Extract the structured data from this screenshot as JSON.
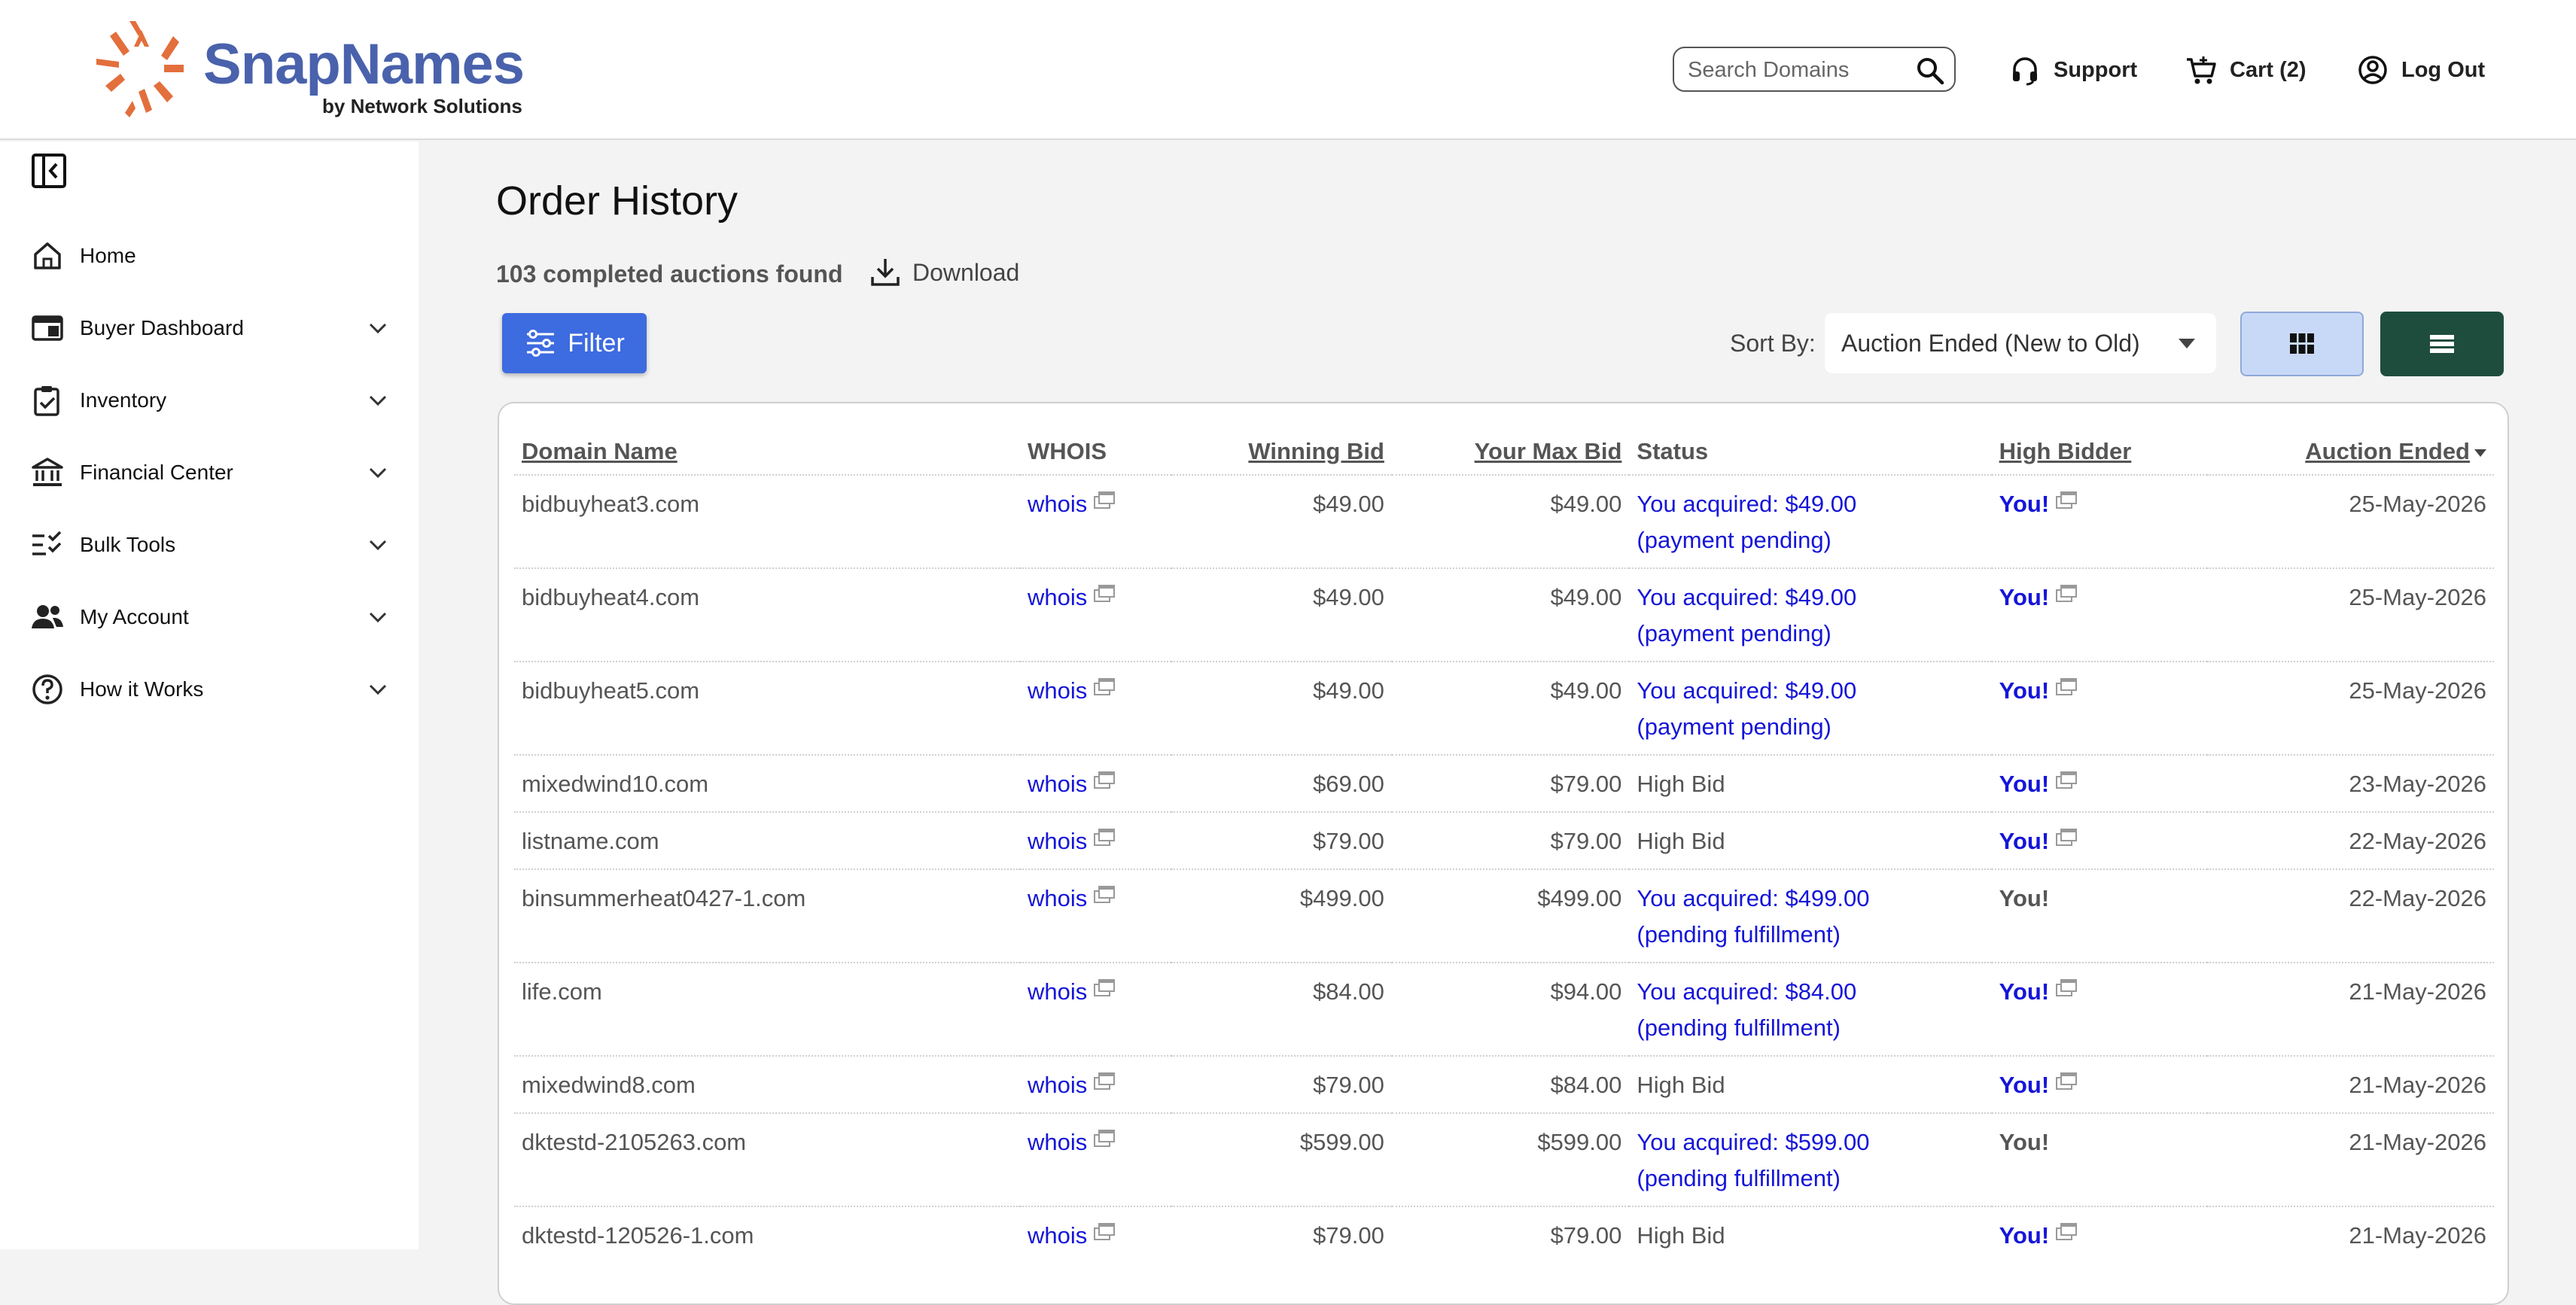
{
  "header": {
    "brand": "SnapNames",
    "brand_sub": "by Network Solutions",
    "search_placeholder": "Search Domains",
    "support_label": "Support",
    "cart_label": "Cart (2)",
    "logout_label": "Log Out"
  },
  "colors": {
    "brand_blue": "#4a62ac",
    "brand_orange": "#e36f3c",
    "filter_blue": "#3d6be0",
    "link_blue": "#1515d8",
    "list_view_green": "#1e4d3e"
  },
  "sidebar": {
    "items": [
      {
        "label": "Home",
        "icon": "home-icon",
        "expandable": false
      },
      {
        "label": "Buyer Dashboard",
        "icon": "dashboard-icon",
        "expandable": true
      },
      {
        "label": "Inventory",
        "icon": "clipboard-icon",
        "expandable": true
      },
      {
        "label": "Financial Center",
        "icon": "bank-icon",
        "expandable": true
      },
      {
        "label": "Bulk Tools",
        "icon": "checklist-icon",
        "expandable": true
      },
      {
        "label": "My Account",
        "icon": "users-icon",
        "expandable": true
      },
      {
        "label": "How it Works",
        "icon": "help-icon",
        "expandable": true
      }
    ]
  },
  "main": {
    "title": "Order History",
    "count_text": "103 completed auctions found",
    "download_label": "Download",
    "filter_label": "Filter",
    "sort_label": "Sort By:",
    "sort_value": "Auction Ended (New to Old)"
  },
  "table": {
    "columns": [
      "Domain Name",
      "WHOIS",
      "Winning Bid",
      "Your Max Bid",
      "Status",
      "High Bidder",
      "Auction Ended"
    ],
    "rows": [
      {
        "domain": "bidbuyheat3.com",
        "whois": "whois",
        "winning": "$49.00",
        "max": "$49.00",
        "status1": "You acquired: $49.00",
        "status2": "(payment pending)",
        "acquired": true,
        "bidder": "You!",
        "bidder_link": true,
        "ended": "25-May-2026"
      },
      {
        "domain": "bidbuyheat4.com",
        "whois": "whois",
        "winning": "$49.00",
        "max": "$49.00",
        "status1": "You acquired: $49.00",
        "status2": "(payment pending)",
        "acquired": true,
        "bidder": "You!",
        "bidder_link": true,
        "ended": "25-May-2026"
      },
      {
        "domain": "bidbuyheat5.com",
        "whois": "whois",
        "winning": "$49.00",
        "max": "$49.00",
        "status1": "You acquired: $49.00",
        "status2": "(payment pending)",
        "acquired": true,
        "bidder": "You!",
        "bidder_link": true,
        "ended": "25-May-2026"
      },
      {
        "domain": "mixedwind10.com",
        "whois": "whois",
        "winning": "$69.00",
        "max": "$79.00",
        "status1": "High Bid",
        "status2": "",
        "acquired": false,
        "bidder": "You!",
        "bidder_link": true,
        "ended": "23-May-2026"
      },
      {
        "domain": "listname.com",
        "whois": "whois",
        "winning": "$79.00",
        "max": "$79.00",
        "status1": "High Bid",
        "status2": "",
        "acquired": false,
        "bidder": "You!",
        "bidder_link": true,
        "ended": "22-May-2026"
      },
      {
        "domain": "binsummerheat0427-1.com",
        "whois": "whois",
        "winning": "$499.00",
        "max": "$499.00",
        "status1": "You acquired: $499.00",
        "status2": "(pending fulfillment)",
        "acquired": true,
        "bidder": "You!",
        "bidder_link": false,
        "ended": "22-May-2026"
      },
      {
        "domain": "life.com",
        "whois": "whois",
        "winning": "$84.00",
        "max": "$94.00",
        "status1": "You acquired: $84.00",
        "status2": "(pending fulfillment)",
        "acquired": true,
        "bidder": "You!",
        "bidder_link": true,
        "ended": "21-May-2026"
      },
      {
        "domain": "mixedwind8.com",
        "whois": "whois",
        "winning": "$79.00",
        "max": "$84.00",
        "status1": "High Bid",
        "status2": "",
        "acquired": false,
        "bidder": "You!",
        "bidder_link": true,
        "ended": "21-May-2026"
      },
      {
        "domain": "dktestd-2105263.com",
        "whois": "whois",
        "winning": "$599.00",
        "max": "$599.00",
        "status1": "You acquired: $599.00",
        "status2": "(pending fulfillment)",
        "acquired": true,
        "bidder": "You!",
        "bidder_link": false,
        "ended": "21-May-2026"
      },
      {
        "domain": "dktestd-120526-1.com",
        "whois": "whois",
        "winning": "$79.00",
        "max": "$79.00",
        "status1": "High Bid",
        "status2": "",
        "acquired": false,
        "bidder": "You!",
        "bidder_link": true,
        "ended": "21-May-2026"
      }
    ]
  }
}
